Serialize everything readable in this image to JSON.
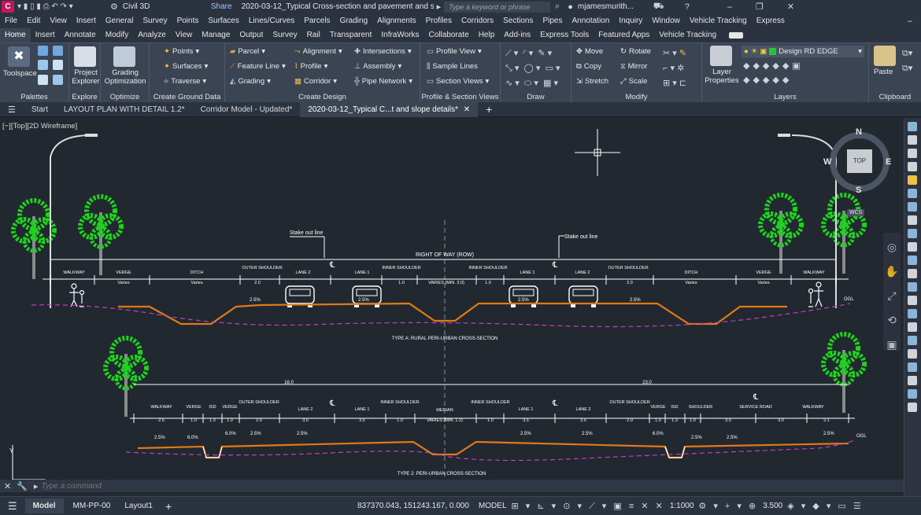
{
  "titlebar": {
    "app_name": "Civil 3D",
    "share": "Share",
    "doc_title": "2020-03-12_Typical Cross-section and pavement and slo...",
    "search_placeholder": "Type a keyword or phrase",
    "user": "mjamesmurith..."
  },
  "menubar": [
    "File",
    "Edit",
    "View",
    "Insert",
    "General",
    "Survey",
    "Points",
    "Surfaces",
    "Lines/Curves",
    "Parcels",
    "Grading",
    "Alignments",
    "Profiles",
    "Corridors",
    "Sections",
    "Pipes",
    "Annotation",
    "Inquiry",
    "Window",
    "Vehicle Tracking",
    "Express"
  ],
  "ribbon_tabs": [
    "Home",
    "Insert",
    "Annotate",
    "Modify",
    "Analyze",
    "View",
    "Manage",
    "Output",
    "Survey",
    "Rail",
    "Transparent",
    "InfraWorks",
    "Collaborate",
    "Help",
    "Add-ins",
    "Express Tools",
    "Featured Apps",
    "Vehicle Tracking"
  ],
  "ribbon": {
    "palettes": {
      "toolspace": "Toolspace",
      "title": "Palettes"
    },
    "explore": {
      "project_explorer": "Project Explorer",
      "title": "Explore"
    },
    "optimize": {
      "grading_optimization": "Grading Optimization",
      "title": "Optimize"
    },
    "ground": {
      "points": "Points",
      "surfaces": "Surfaces",
      "traverse": "Traverse",
      "title": "Create Ground Data"
    },
    "design": {
      "parcel": "Parcel",
      "feature_line": "Feature Line",
      "grading": "Grading",
      "alignment": "Alignment",
      "profile": "Profile",
      "corridor": "Corridor",
      "intersections": "Intersections",
      "assembly": "Assembly",
      "pipe_network": "Pipe Network",
      "title": "Create Design"
    },
    "profile_section": {
      "profile_view": "Profile View",
      "sample_lines": "Sample Lines",
      "section_views": "Section Views",
      "title": "Profile & Section Views"
    },
    "draw": {
      "title": "Draw"
    },
    "modify": {
      "move": "Move",
      "rotate": "Rotate",
      "copy": "Copy",
      "mirror": "Mirror",
      "stretch": "Stretch",
      "scale": "Scale",
      "title": "Modify"
    },
    "layers": {
      "layer_properties": "Layer Properties",
      "current_layer": "Design RD EDGE",
      "title": "Layers"
    },
    "clipboard": {
      "paste": "Paste",
      "title": "Clipboard"
    }
  },
  "doc_tabs": [
    "Start",
    "LAYOUT PLAN WITH DETAIL 1.2*",
    "Corridor Model - Updated*",
    "2020-03-12_Typical C...t and slope details*"
  ],
  "viewport": {
    "view_label": "[−][Top][2D Wireframe]",
    "viewcube": {
      "top": "TOP",
      "n": "N",
      "s": "S",
      "e": "E",
      "w": "W",
      "wcs": "WCS"
    },
    "section_a": {
      "title": "TYPE A: RURAL PERI-URBAN CROSS-SECTION",
      "stake_left": "Stake out line",
      "stake_right": "Stake out line",
      "row": "RIGHT OF WAY (ROW)",
      "labels": [
        "WALKWAY",
        "VERGE",
        "DITCH",
        "OUTER SHOULDER",
        "LANE 2",
        "LANE 1",
        "INNER SHOULDER",
        "INNER SHOULDER",
        "LANE 1",
        "LANE 2",
        "OUTER SHOULDER",
        "DITCH",
        "VERGE",
        "WALKWAY"
      ],
      "dims": [
        "Varies",
        "Varies",
        "2.0",
        "1.0",
        "VARIES (MIN. 3.0)",
        "1.0",
        "2.0",
        "Varies",
        "Varies"
      ],
      "slopes": [
        "2.5%",
        "2.5%",
        "2.5%",
        "2.5%"
      ],
      "ogl": "OGL"
    },
    "section_b": {
      "title": "TYPE 2: PERI-URBAN CROSS-SECTION",
      "overall_left": "16.0",
      "overall_right": "23.0",
      "labels": [
        "WALKWAY",
        "VERGE",
        "ISD",
        "VERGE",
        "OUTER SHOULDER",
        "LANE 2",
        "LANE 1",
        "INNER SHOULDER",
        "MEDIAN",
        "INNER SHOULDER",
        "LANE 1",
        "LANE 2",
        "OUTER SHOULDER",
        "VERGE",
        "ISD",
        "SHOULDER",
        "SERVICE ROAD",
        "WALKWAY"
      ],
      "dims": [
        "2.5",
        "1.0",
        "1.3",
        "1.0",
        "2.0",
        "3.5",
        "3.5",
        "1.0",
        "VARIES (MIN. 1.2)",
        "1.0",
        "3.5",
        "3.5",
        "2.0",
        "1.0",
        "1.3",
        "1.0",
        "3.0",
        "3.0",
        "2.1"
      ],
      "slopes": [
        "2.5%",
        "6.0%",
        "6.0%",
        "2.5%",
        "2.5%",
        "2.5%",
        "2.5%",
        "6.0%",
        "2.5%",
        "2.5%",
        "2.5%"
      ],
      "ogl": "OGL"
    },
    "command_placeholder": "Type a command"
  },
  "statusbar": {
    "model_tab": "Model",
    "layouts": [
      "MM-PP-00",
      "Layout1"
    ],
    "coords": "837370.043, 151243.167, 0.000",
    "mode": "MODEL",
    "scale": "1:1000",
    "value": "3.500"
  },
  "colors": {
    "tree": "#1ed21e",
    "road": "#e07a18",
    "ogl": "#c040c0",
    "lines": "#ffffff",
    "bg": "#212830"
  }
}
